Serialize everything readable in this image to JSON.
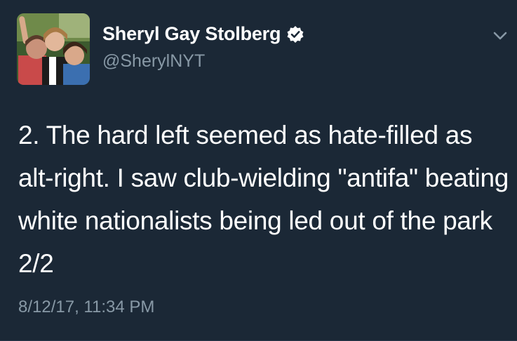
{
  "tweet": {
    "author": {
      "display_name": "Sheryl Gay Stolberg",
      "handle": "@SherylNYT",
      "verified": true
    },
    "text": "2. The hard left seemed as hate-filled as alt-right. I saw club-wielding \"antifa\" beating white nationalists being led out of the park 2/2",
    "timestamp": "8/12/17, 11:34 PM"
  },
  "icons": {
    "verified": "verified-badge-icon",
    "menu": "chevron-down-icon"
  },
  "colors": {
    "background": "#1b2836",
    "primary_text": "#ffffff",
    "secondary_text": "#8899a6"
  }
}
